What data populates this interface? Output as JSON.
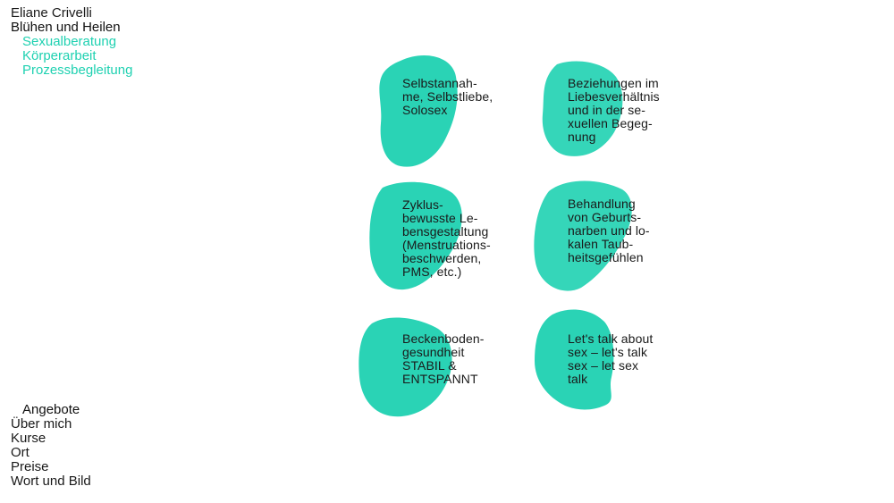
{
  "site": {
    "owner_name": "Eliane Crivelli",
    "section_title": "Blühen und Heilen",
    "subnav": [
      "Sexualberatung",
      "Körperarbeit",
      "Prozessbegleitung"
    ]
  },
  "main_nav": {
    "active": "Angebote",
    "items": [
      "Über mich",
      "Kurse",
      "Ort",
      "Preise",
      "Wort und Bild"
    ]
  },
  "colors": {
    "accent": "#1fd1b1",
    "text": "#1a1a1a"
  },
  "offers": [
    {
      "text": "Selbstannah-\nme, Selbstliebe,\nSolosex"
    },
    {
      "text": "Beziehungen im\nLiebesverhältnis\nund in der se-\nxuellen Begeg-\nnung"
    },
    {
      "text": "Zyklus-\nbewusste Le-\nbensgestaltung\n(Menstruations-\nbeschwerden,\nPMS, etc.)"
    },
    {
      "text": "Behandlung\nvon Geburts-\nnarben und lo-\nkalen Taub-\nheitsgefühlen"
    },
    {
      "text": "Beckenboden-\ngesundheit\nSTABIL &\nENTSPANNT"
    },
    {
      "text": "Let's talk about\nsex – let's talk\nsex – let sex\ntalk"
    }
  ]
}
